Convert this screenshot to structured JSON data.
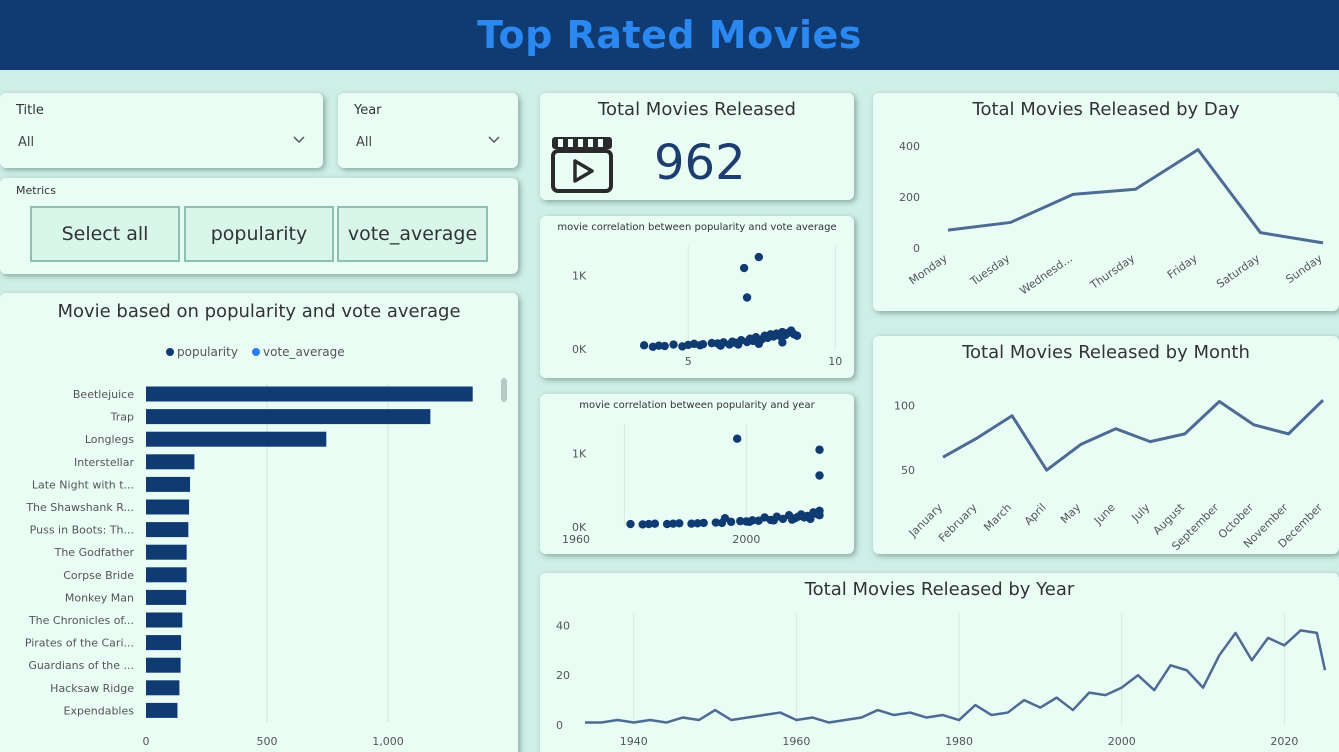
{
  "header": {
    "title": "Top Rated Movies"
  },
  "filters": {
    "title": {
      "label": "Title",
      "value": "All"
    },
    "year": {
      "label": "Year",
      "value": "All"
    }
  },
  "metrics": {
    "label": "Metrics",
    "buttons": [
      "Select all",
      "popularity",
      "vote_average"
    ]
  },
  "kpi": {
    "title": "Total Movies Released",
    "value": "962",
    "icon": "film-clapper-icon"
  },
  "colors": {
    "header_bg": "#0f3b72",
    "title": "#2a88f0",
    "series_popularity": "#0f3b72",
    "series_vote": "#2a7bf0",
    "line": "#4d6b93"
  },
  "chart_data": [
    {
      "id": "bar",
      "type": "bar",
      "orientation": "horizontal",
      "title": "Movie based on popularity and vote average",
      "legend": [
        "popularity",
        "vote_average"
      ],
      "legend_position": "top",
      "categories": [
        "Beetlejuice",
        "Trap",
        "Longlegs",
        "Interstellar",
        "Late Night with t...",
        "The Shawshank R...",
        "Puss in Boots: Th...",
        "The Godfather",
        "Corpse Bride",
        "Monkey Man",
        "The Chronicles of...",
        "Pirates of the Cari...",
        "Guardians of the ...",
        "Hacksaw Ridge",
        "Expendables"
      ],
      "series": [
        {
          "name": "popularity",
          "values": [
            1350,
            1175,
            745,
            200,
            182,
            178,
            175,
            168,
            168,
            166,
            150,
            145,
            143,
            138,
            130
          ]
        }
      ],
      "xticks": [
        "0",
        "500",
        "1,000"
      ],
      "xlim": [
        0,
        1500
      ]
    },
    {
      "id": "scatter1",
      "type": "scatter",
      "title": "movie correlation between popularity and vote average",
      "xticks": [
        "5",
        "10"
      ],
      "yticks": [
        "1K",
        "0K"
      ],
      "xlim": [
        2,
        10.5
      ],
      "ylim": [
        0,
        1400
      ],
      "points": [
        [
          6.9,
          1100
        ],
        [
          7.4,
          1250
        ],
        [
          7.0,
          700
        ],
        [
          3.5,
          50
        ],
        [
          4.0,
          45
        ],
        [
          4.5,
          60
        ],
        [
          5.0,
          55
        ],
        [
          5.2,
          70
        ],
        [
          5.5,
          65
        ],
        [
          5.8,
          80
        ],
        [
          6.0,
          75
        ],
        [
          6.2,
          90
        ],
        [
          6.4,
          60
        ],
        [
          6.5,
          100
        ],
        [
          6.6,
          85
        ],
        [
          6.8,
          120
        ],
        [
          7.0,
          95
        ],
        [
          7.1,
          140
        ],
        [
          7.2,
          110
        ],
        [
          7.3,
          160
        ],
        [
          7.5,
          130
        ],
        [
          7.6,
          180
        ],
        [
          7.7,
          150
        ],
        [
          7.8,
          200
        ],
        [
          7.9,
          170
        ],
        [
          8.0,
          210
        ],
        [
          8.1,
          180
        ],
        [
          8.2,
          230
        ],
        [
          8.3,
          190
        ],
        [
          8.4,
          220
        ],
        [
          8.5,
          250
        ],
        [
          8.6,
          200
        ],
        [
          3.8,
          30
        ],
        [
          4.2,
          40
        ],
        [
          4.8,
          35
        ],
        [
          5.4,
          50
        ],
        [
          6.1,
          45
        ],
        [
          6.7,
          60
        ],
        [
          7.4,
          70
        ],
        [
          8.2,
          90
        ],
        [
          8.7,
          180
        ]
      ]
    },
    {
      "id": "scatter2",
      "type": "scatter",
      "title": "movie correlation between popularity and year",
      "xticks": [
        "1960",
        "2000"
      ],
      "yticks": [
        "1K",
        "0K"
      ],
      "xlim": [
        1952,
        2034
      ],
      "ylim": [
        0,
        1400
      ],
      "points": [
        [
          1997,
          1200
        ],
        [
          2024,
          1050
        ],
        [
          2024,
          700
        ],
        [
          1962,
          40
        ],
        [
          1966,
          35
        ],
        [
          1970,
          45
        ],
        [
          1974,
          40
        ],
        [
          1978,
          50
        ],
        [
          1982,
          45
        ],
        [
          1986,
          55
        ],
        [
          1990,
          60
        ],
        [
          1993,
          120
        ],
        [
          1995,
          70
        ],
        [
          1998,
          80
        ],
        [
          2000,
          75
        ],
        [
          2002,
          90
        ],
        [
          2004,
          85
        ],
        [
          2006,
          130
        ],
        [
          2008,
          95
        ],
        [
          2010,
          140
        ],
        [
          2012,
          110
        ],
        [
          2014,
          160
        ],
        [
          2016,
          120
        ],
        [
          2018,
          170
        ],
        [
          2019,
          130
        ],
        [
          2020,
          150
        ],
        [
          2021,
          140
        ],
        [
          2022,
          200
        ],
        [
          2023,
          180
        ],
        [
          2024,
          220
        ],
        [
          2024,
          160
        ],
        [
          1968,
          40
        ],
        [
          1976,
          45
        ],
        [
          1984,
          50
        ],
        [
          1992,
          55
        ],
        [
          2001,
          70
        ],
        [
          2009,
          90
        ],
        [
          2015,
          100
        ],
        [
          2017,
          140
        ],
        [
          2021,
          110
        ]
      ]
    },
    {
      "id": "day",
      "type": "line",
      "title": "Total Movies Released by Day",
      "categories": [
        "Monday",
        "Tuesday",
        "Wednesd...",
        "Thursday",
        "Friday",
        "Saturday",
        "Sunday"
      ],
      "values": [
        70,
        100,
        210,
        230,
        385,
        60,
        20
      ],
      "yticks": [
        0,
        200,
        400
      ],
      "ylim": [
        0,
        450
      ]
    },
    {
      "id": "month",
      "type": "line",
      "title": "Total Movies Released by Month",
      "categories": [
        "January",
        "February",
        "March",
        "April",
        "May",
        "June",
        "July",
        "August",
        "September",
        "October",
        "November",
        "December"
      ],
      "values": [
        60,
        75,
        92,
        50,
        70,
        82,
        72,
        78,
        103,
        85,
        78,
        104
      ],
      "yticks": [
        50,
        100
      ],
      "ylim": [
        30,
        115
      ]
    },
    {
      "id": "year",
      "type": "line",
      "title": "Total Movies Released by Year",
      "xticks": [
        "1940",
        "1960",
        "1980",
        "2000",
        "2020"
      ],
      "yticks": [
        0,
        20,
        40
      ],
      "xlim": [
        1934,
        2025
      ],
      "ylim": [
        0,
        45
      ],
      "x": [
        1934,
        1936,
        1938,
        1940,
        1942,
        1944,
        1946,
        1948,
        1950,
        1952,
        1954,
        1956,
        1958,
        1960,
        1962,
        1964,
        1966,
        1968,
        1970,
        1972,
        1974,
        1976,
        1978,
        1980,
        1982,
        1984,
        1986,
        1988,
        1990,
        1992,
        1994,
        1996,
        1998,
        2000,
        2002,
        2004,
        2006,
        2008,
        2010,
        2012,
        2014,
        2016,
        2018,
        2020,
        2022,
        2024,
        2025
      ],
      "values": [
        1,
        1,
        2,
        1,
        2,
        1,
        3,
        2,
        6,
        2,
        3,
        4,
        5,
        2,
        3,
        1,
        2,
        3,
        6,
        4,
        5,
        3,
        4,
        2,
        8,
        4,
        5,
        10,
        7,
        11,
        6,
        13,
        12,
        15,
        20,
        14,
        24,
        22,
        15,
        28,
        37,
        26,
        35,
        32,
        38,
        37,
        22,
        10,
        9
      ]
    }
  ]
}
